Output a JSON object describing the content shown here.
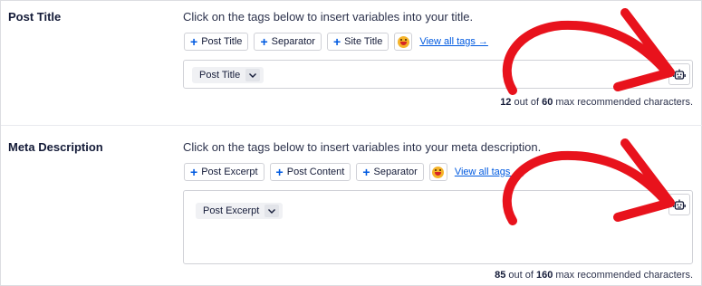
{
  "sections": [
    {
      "label": "Post Title",
      "help": "Click on the tags below to insert variables into your title.",
      "tags": [
        "Post Title",
        "Separator",
        "Site Title"
      ],
      "view_all": "View all tags →",
      "chip": "Post Title",
      "counter": {
        "count": "12",
        "middle": " out of ",
        "max": "60",
        "suffix": " max recommended characters."
      }
    },
    {
      "label": "Meta Description",
      "help": "Click on the tags below to insert variables into your meta description.",
      "tags": [
        "Post Excerpt",
        "Post Content",
        "Separator"
      ],
      "view_all": "View all tags →",
      "chip": "Post Excerpt",
      "counter": {
        "count": "85",
        "middle": " out of ",
        "max": "160",
        "suffix": " max recommended characters."
      }
    }
  ],
  "icons": {
    "tag_plus": "plus-icon",
    "emoji": "emoji-icon",
    "chip_caret": "chevron-down-icon",
    "ai_button": "robot-icon",
    "annotation": "red-arrow-annotation"
  },
  "colors": {
    "link": "#005ae0",
    "annotation_red": "#e8121c",
    "text": "#141b38"
  }
}
